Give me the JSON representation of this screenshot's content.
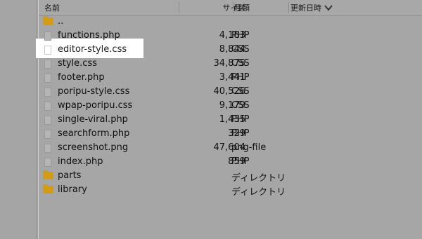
{
  "header": {
    "name_label": "名前",
    "size_label": "サイズ",
    "type_label": "種類",
    "date_label": "更新日時",
    "sort_icon": "chevron-down-icon"
  },
  "rows": [
    {
      "icon": "folder-icon",
      "name": "..",
      "size": "",
      "type": ""
    },
    {
      "icon": "file-icon",
      "name": "functions.php",
      "size": "4,183",
      "type": "PHP"
    },
    {
      "icon": "file-icon",
      "name": "editor-style.css",
      "size": "8,844",
      "type": "CSS",
      "selected": true
    },
    {
      "icon": "file-icon",
      "name": "style.css",
      "size": "34,875",
      "type": "CSS"
    },
    {
      "icon": "file-icon",
      "name": "footer.php",
      "size": "3,441",
      "type": "PHP"
    },
    {
      "icon": "file-icon",
      "name": "poripu-style.css",
      "size": "40,526",
      "type": "CSS"
    },
    {
      "icon": "file-icon",
      "name": "wpap-poripu.css",
      "size": "9,179",
      "type": "CSS"
    },
    {
      "icon": "file-icon",
      "name": "single-viral.php",
      "size": "1,435",
      "type": "PHP"
    },
    {
      "icon": "file-icon",
      "name": "searchform.php",
      "size": "329",
      "type": "PHP"
    },
    {
      "icon": "file-icon",
      "name": "screenshot.png",
      "size": "47,604",
      "type": "png-file"
    },
    {
      "icon": "file-icon",
      "name": "index.php",
      "size": "859",
      "type": "PHP"
    },
    {
      "icon": "folder-icon",
      "name": "parts",
      "size": "",
      "type": "ディレクトリ"
    },
    {
      "icon": "folder-icon",
      "name": "library",
      "size": "",
      "type": "ディレクトリ"
    }
  ],
  "colors": {
    "background": "#a7a7a7",
    "folder": "#d49b14",
    "highlight": "#ffffff"
  }
}
